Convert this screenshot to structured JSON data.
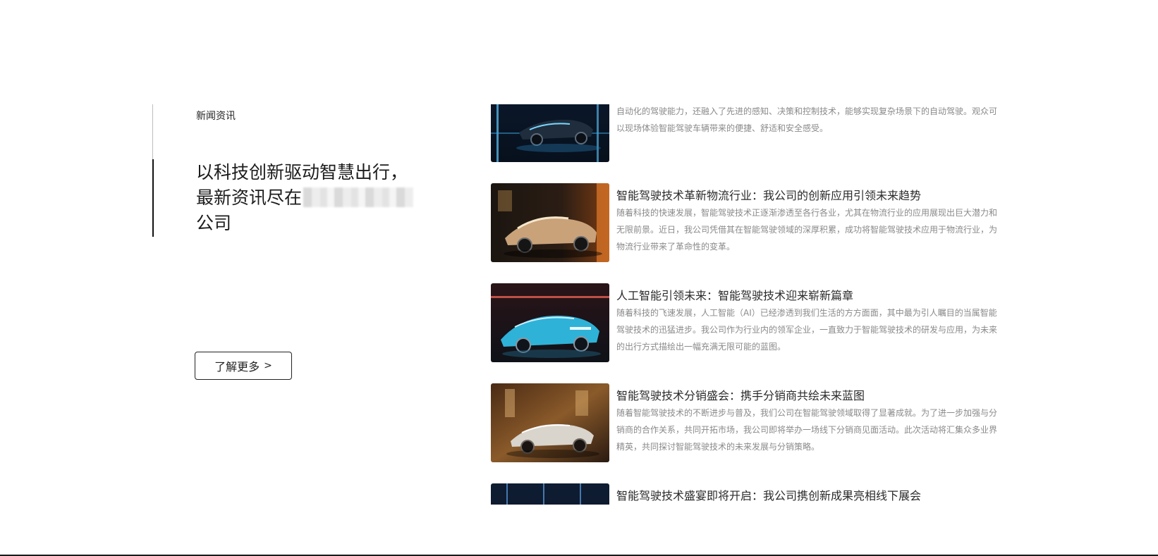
{
  "section": {
    "label": "新闻资讯",
    "headline_line1": "以科技创新驱动智慧出行，",
    "headline_line2_prefix": "最新资讯尽在",
    "headline_line3": "公司",
    "more_button": "了解更多",
    "more_chevron": ">"
  },
  "news": [
    {
      "title": "",
      "desc": "在展会上，我们将展出多款搭载智能驾驶技术的车辆，包括乘用车、商用车等。这些车辆不仅具备高度自动化的驾驶能力，还融入了先进的感知、决策和控制技术，能够实现复杂场景下的自动驾驶。观众可以现场体验智能驾驶车辆带来的便捷、舒适和安全感受。"
    },
    {
      "title": "智能驾驶技术革新物流行业：我公司的创新应用引领未来趋势",
      "desc": "随着科技的快速发展，智能驾驶技术正逐渐渗透至各行各业，尤其在物流行业的应用展现出巨大潜力和无限前景。近日，我公司凭借其在智能驾驶领域的深厚积累，成功将智能驾驶技术应用于物流行业，为物流行业带来了革命性的变革。"
    },
    {
      "title": "人工智能引领未来：智能驾驶技术迎来崭新篇章",
      "desc": "随着科技的飞速发展，人工智能（AI）已经渗透到我们生活的方方面面，其中最为引人瞩目的当属智能驾驶技术的迅猛进步。我公司作为行业内的领军企业，一直致力于智能驾驶技术的研发与应用，为未来的出行方式描绘出一幅充满无限可能的蓝图。"
    },
    {
      "title": "智能驾驶技术分销盛会：携手分销商共绘未来蓝图",
      "desc": "随着智能驾驶技术的不断进步与普及，我们公司在智能驾驶领域取得了显著成就。为了进一步加强与分销商的合作关系，共同开拓市场，我公司即将举办一场线下分销商见面活动。此次活动将汇集众多业界精英，共同探讨智能驾驶技术的未来发展与分销策略。"
    },
    {
      "title": "智能驾驶技术盛宴即将开启：我公司携创新成果亮相线下展会",
      "desc": ""
    }
  ]
}
